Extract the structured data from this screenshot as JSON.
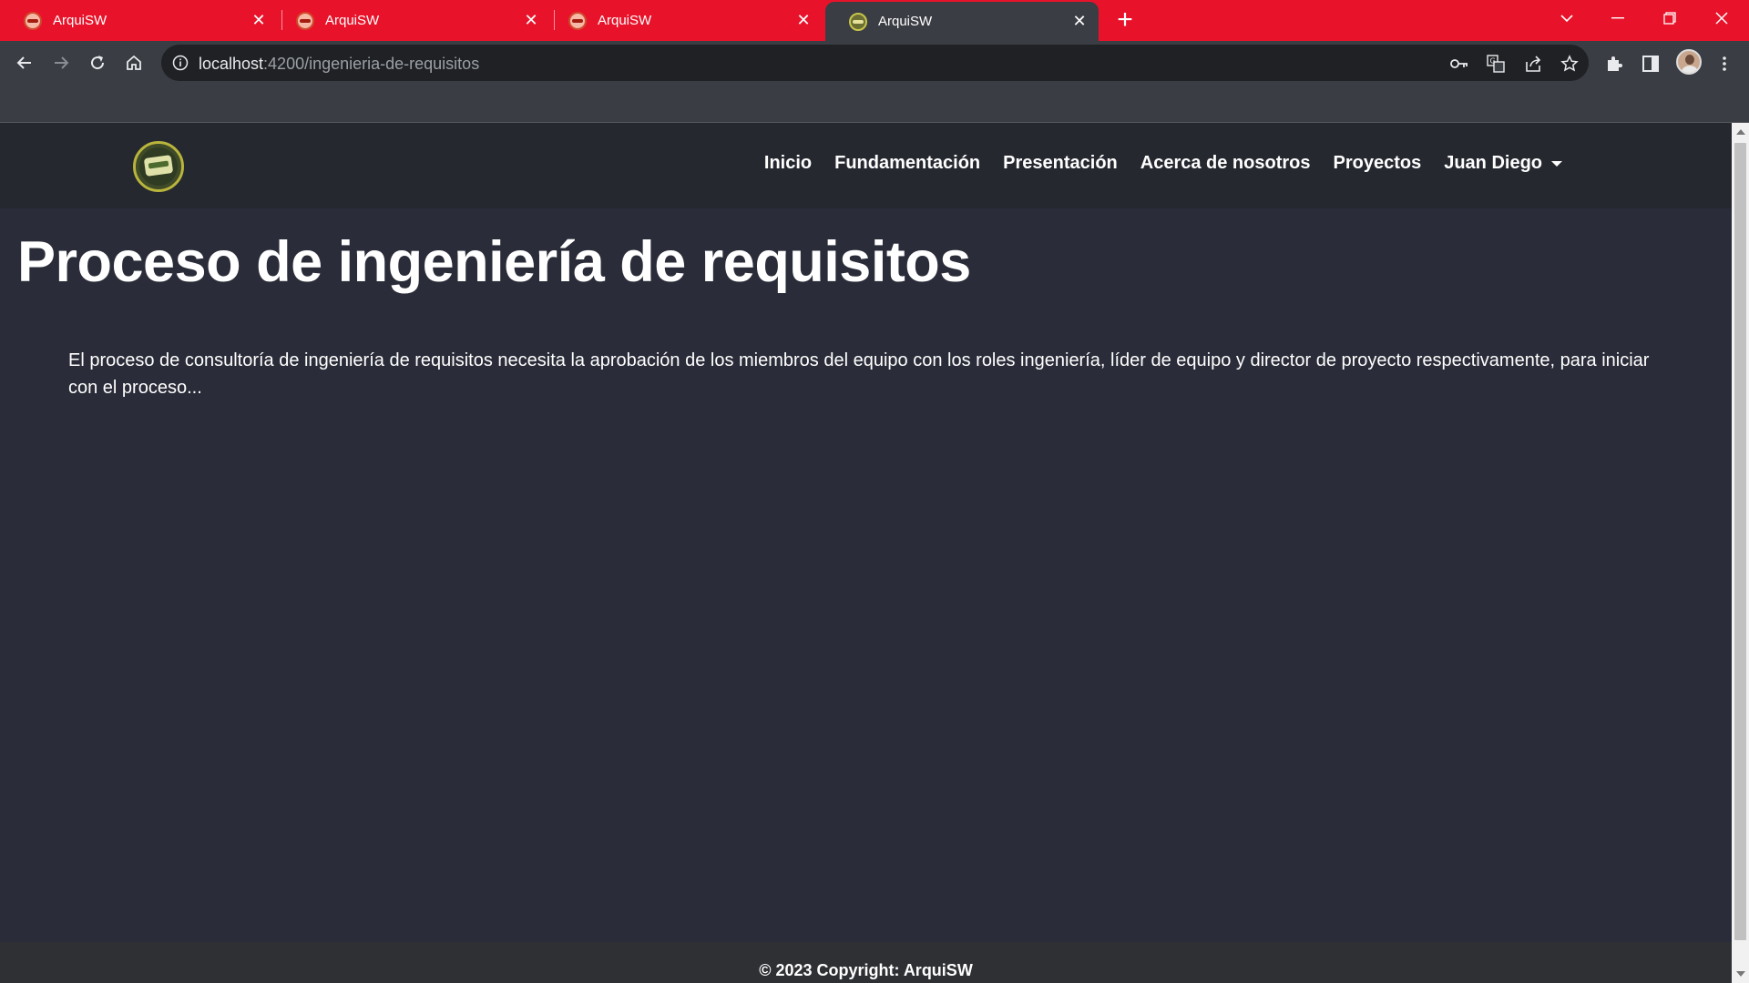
{
  "browser": {
    "tabs": [
      {
        "title": "ArquiSW",
        "active": false
      },
      {
        "title": "ArquiSW",
        "active": false
      },
      {
        "title": "ArquiSW",
        "active": false
      },
      {
        "title": "ArquiSW",
        "active": true
      }
    ],
    "new_tab": "+",
    "close_glyph": "✕",
    "address": {
      "host": "localhost",
      "path": ":4200/ingenieria-de-requisitos"
    },
    "colors": {
      "tabstrip": "#e8132a",
      "toolbar": "#3a3d44",
      "omnibox": "#202124"
    }
  },
  "site": {
    "nav": {
      "links": [
        "Inicio",
        "Fundamentación",
        "Presentación",
        "Acerca de nosotros",
        "Proyectos"
      ],
      "user": "Juan Diego"
    },
    "title": "Proceso de ingeniería de requisitos",
    "body": "El proceso de consultoría de ingeniería de requisitos necesita la aprobación de los miembros del equipo con los roles ingeniería, líder de equipo y director de proyecto respectivamente, para iniciar con el proceso...",
    "footer": "© 2023 Copyright: ArquiSW",
    "colors": {
      "background": "#2a2d39",
      "navbar": "#25282f",
      "footer": "#2f3034",
      "text": "#ffffff"
    }
  }
}
